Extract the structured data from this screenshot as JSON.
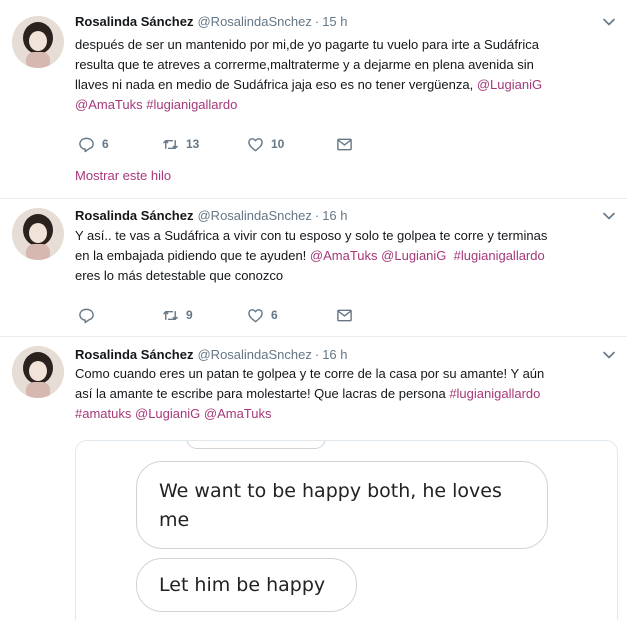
{
  "tweets": [
    {
      "name": "Rosalinda Sánchez",
      "handle": "@RosalindaSnchez",
      "separator": "·",
      "time": "15 h",
      "text_lines": [
        [
          {
            "t": "después de ser un mantenido por mi,de yo pagarte tu vuelo para irte a Sudáfrica"
          }
        ],
        [
          {
            "t": "resulta que te atreves a correrme,maltraterme y a dejarme en plena avenida sin"
          }
        ],
        [
          {
            "t": "llaves ni nada en medio de Sudáfrica jaja eso es no tener vergüenza, "
          },
          {
            "t": "@LugianiG",
            "link": true
          }
        ],
        [
          {
            "t": "@AmaTuks",
            "link": true
          },
          {
            "t": " "
          },
          {
            "t": "#lugianigallardo",
            "link": true
          }
        ]
      ],
      "replies": "6",
      "retweets": "13",
      "likes": "10",
      "show_thread": "Mostrar este hilo"
    },
    {
      "name": "Rosalinda Sánchez",
      "handle": "@RosalindaSnchez",
      "separator": "·",
      "time": "16 h",
      "text_lines": [
        [
          {
            "t": "Y así.. te vas a Sudáfrica a vivir con tu esposo y solo te golpea te corre y terminas"
          }
        ],
        [
          {
            "t": "en la embajada pidiendo que te ayuden! "
          },
          {
            "t": "@AmaTuks",
            "link": true
          },
          {
            "t": " "
          },
          {
            "t": "@LugianiG",
            "link": true
          },
          {
            "t": "  "
          },
          {
            "t": "#lugianigallardo",
            "link": true
          }
        ],
        [
          {
            "t": "eres lo más detestable que conozco"
          }
        ]
      ],
      "replies": "",
      "retweets": "9",
      "likes": "6"
    },
    {
      "name": "Rosalinda Sánchez",
      "handle": "@RosalindaSnchez",
      "separator": "·",
      "time": "16 h",
      "text_lines": [
        [
          {
            "t": "Como cuando eres un patan te golpea y te corre de la casa por su amante! Y aún"
          }
        ],
        [
          {
            "t": "así la amante te escribe para molestarte! Que lacras de persona "
          },
          {
            "t": "#lugianigallardo",
            "link": true
          }
        ],
        [
          {
            "t": "#amatuks",
            "link": true
          },
          {
            "t": " "
          },
          {
            "t": "@LugianiG",
            "link": true
          },
          {
            "t": " "
          },
          {
            "t": "@AmaTuks",
            "link": true
          }
        ]
      ]
    }
  ],
  "media": {
    "bubbles": [
      "We want to be happy both, he loves me",
      "Let him be happy"
    ]
  },
  "colors": {
    "link": "#a6387a",
    "muted": "#657786",
    "divider": "#e6ecf0"
  }
}
